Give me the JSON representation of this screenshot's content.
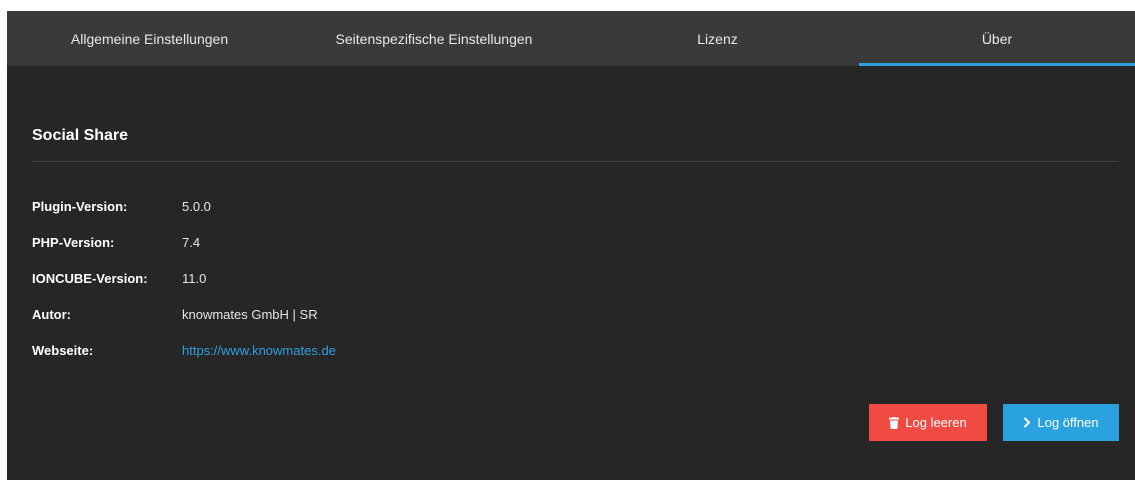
{
  "tabs": [
    {
      "label": "Allgemeine Einstellungen"
    },
    {
      "label": "Seitenspezifische Einstellungen"
    },
    {
      "label": "Lizenz"
    },
    {
      "label": "Über",
      "active": true
    }
  ],
  "section": {
    "title": "Social Share"
  },
  "info": {
    "plugin_version": {
      "label": "Plugin-Version:",
      "value": "5.0.0"
    },
    "php_version": {
      "label": "PHP-Version:",
      "value": "7.4"
    },
    "ioncube_version": {
      "label": "IONCUBE-Version:",
      "value": "11.0"
    },
    "author": {
      "label": "Autor:",
      "value": "knowmates GmbH | SR"
    },
    "website": {
      "label": "Webseite:",
      "value": "https://www.knowmates.de"
    }
  },
  "buttons": {
    "clear_log": {
      "label": "Log leeren",
      "icon": "trash-icon",
      "color": "#f04a43"
    },
    "open_log": {
      "label": "Log öffnen",
      "icon": "chevron-right-icon",
      "color": "#2ba2e0"
    }
  },
  "colors": {
    "accent": "#2fa0e0",
    "background": "#262626",
    "tabbar": "#3a3a3a"
  }
}
